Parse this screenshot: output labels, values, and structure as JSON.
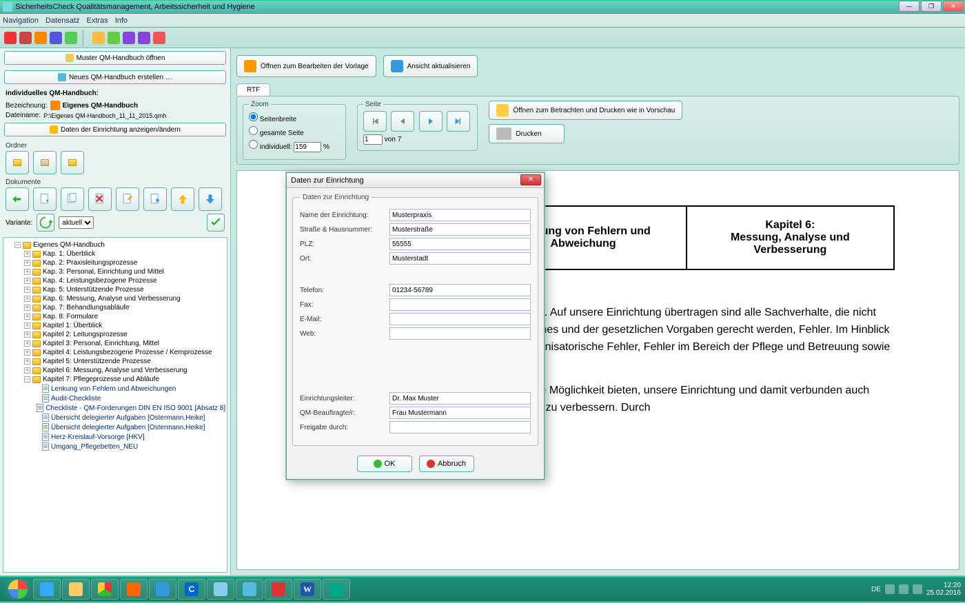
{
  "window": {
    "title": "SicherheitsCheck Qualitätsmanagement, Arbeitssicherheit und Hygiene",
    "min": "—",
    "max": "❐",
    "close": "✕"
  },
  "menus": [
    "Navigation",
    "Datensatz",
    "Extras",
    "Info"
  ],
  "sidebar": {
    "btn_open_sample": "Muster QM-Handbuch öffnen",
    "btn_new": "Neues QM-Handbuch erstellen …",
    "heading": "individuelles QM-Handbuch:",
    "label_name": "Bezeichnung:",
    "value_name": "Eigenes QM-Handbuch",
    "label_file": "Dateiname:",
    "value_file": "P:\\Eigenes QM-Handbuch_11_11_2015.qmh",
    "btn_editdata": "Daten der Einrichtung anzeigen/ändern",
    "group_folder": "Ordner",
    "group_docs": "Dokumente",
    "group_variant": "Variante:",
    "variant_value": "aktuell"
  },
  "tree": {
    "root": "Eigenes QM-Handbuch",
    "chapters": [
      "Kap. 1: Überblick",
      "Kap. 2: Praxisleitungsprozesse",
      "Kap. 3: Personal, Einrichtung und Mittel",
      "Kap. 4: Leistungsbezogene Prozesse",
      "Kap. 5: Unterstützende Prozesse",
      "Kap. 6: Messung, Analyse und Verbesserung",
      "Kap. 7: Behandlungsabläufe",
      "Kap. 8: Formulare",
      "Kapitel 1: Überblick",
      "Kapitel 2: Leitungsprozesse",
      "Kapitel 3: Personal, Einrichtung, Mittel",
      "Kapitel 4: Leistungsbezogene Prozesse / Kernprozesse",
      "Kapitel 5: Unterstützende Prozesse",
      "Kapitel 6: Messung, Analyse und Verbesserung",
      "Kapitel 7: Pflegeprozesse und Abläufe"
    ],
    "docs": [
      "Lenkung von Fehlern und Abweichungen",
      "Audit-Checkliste",
      "Checkliste - QM-Forderungen DIN EN ISO 9001 [Absatz 8]",
      "Übersicht delegierter Aufgaben [Ostermann,Heike]",
      "Übersicht delegierter Aufgaben [Ostermann,Heike]",
      "Herz-Kreislauf-Vorsorge [HKV]",
      "Umgang_Pflegebetten_NEU"
    ]
  },
  "content": {
    "btn_edit_template": "Öffnen zum Bearbeiten der Vorlage",
    "btn_refresh": "Ansicht aktualisieren",
    "tab_rtf": "RTF",
    "zoom_label": "Zoom",
    "zoom_opt1": "Seitenbreite",
    "zoom_opt2": "gesamte Seite",
    "zoom_opt3": "individuell:",
    "zoom_value": "159",
    "zoom_pct": "%",
    "page_label": "Seite",
    "page_cur": "1",
    "page_of": "von",
    "page_total": "7",
    "btn_preview": "Öffnen zum Betrachten und Drucken wie in Vorschau",
    "btn_print": "Drucken"
  },
  "doc": {
    "cell1": "Lenkung von Fehlern und Abweichung",
    "cell2a": "Kapitel 6:",
    "cell2b": "Messung, Analyse und Verbesserung",
    "p1": "O 9000:2008 die Nichterfüllung einer Anforderung. Auf unsere Einrichtung übertragen sind alle Sachverhalte, die nicht den festgelegten Anforderungen dieses Handbuches und der gesetzlichen Vorgaben gerecht werden, Fehler. Im Hinblick auf die Vorgehensweise unterscheiden wir in organisatorische Fehler, Fehler im Bereich der Pflege und Betreuung sowie Beschwerden.",
    "p2": "Fehler sind als Chancen zu verstehen, die uns die Möglichkeit bieten, unsere Einrichtung und damit verbunden auch unser Qualitätsmanagementsystem kontinuierlich zu verbessern. Durch"
  },
  "modal": {
    "title": "Daten zur Einrichtung",
    "legend": "Daten zur Einrichtung",
    "fields": {
      "name": {
        "label": "Name der Einrichtung:",
        "value": "Musterpraxis"
      },
      "street": {
        "label": "Straße & Hausnummer:",
        "value": "Musterstraße"
      },
      "plz": {
        "label": "PLZ:",
        "value": "55555"
      },
      "ort": {
        "label": "Ort:",
        "value": "Musterstadt"
      },
      "tel": {
        "label": "Telefon:",
        "value": "01234-56789"
      },
      "fax": {
        "label": "Fax:",
        "value": ""
      },
      "email": {
        "label": "E-Mail:",
        "value": ""
      },
      "web": {
        "label": "Web:",
        "value": ""
      },
      "leiter": {
        "label": "Einrichtungsleiter:",
        "value": "Dr. Max Muster"
      },
      "qm": {
        "label": "QM-Beauftragte/r:",
        "value": "Frau Mustermann"
      },
      "freigabe": {
        "label": "Freigabe durch:",
        "value": ""
      }
    },
    "ok": "OK",
    "cancel": "Abbruch"
  },
  "taskbar": {
    "lang": "DE",
    "time": "12:20",
    "date": "25.02.2016"
  }
}
